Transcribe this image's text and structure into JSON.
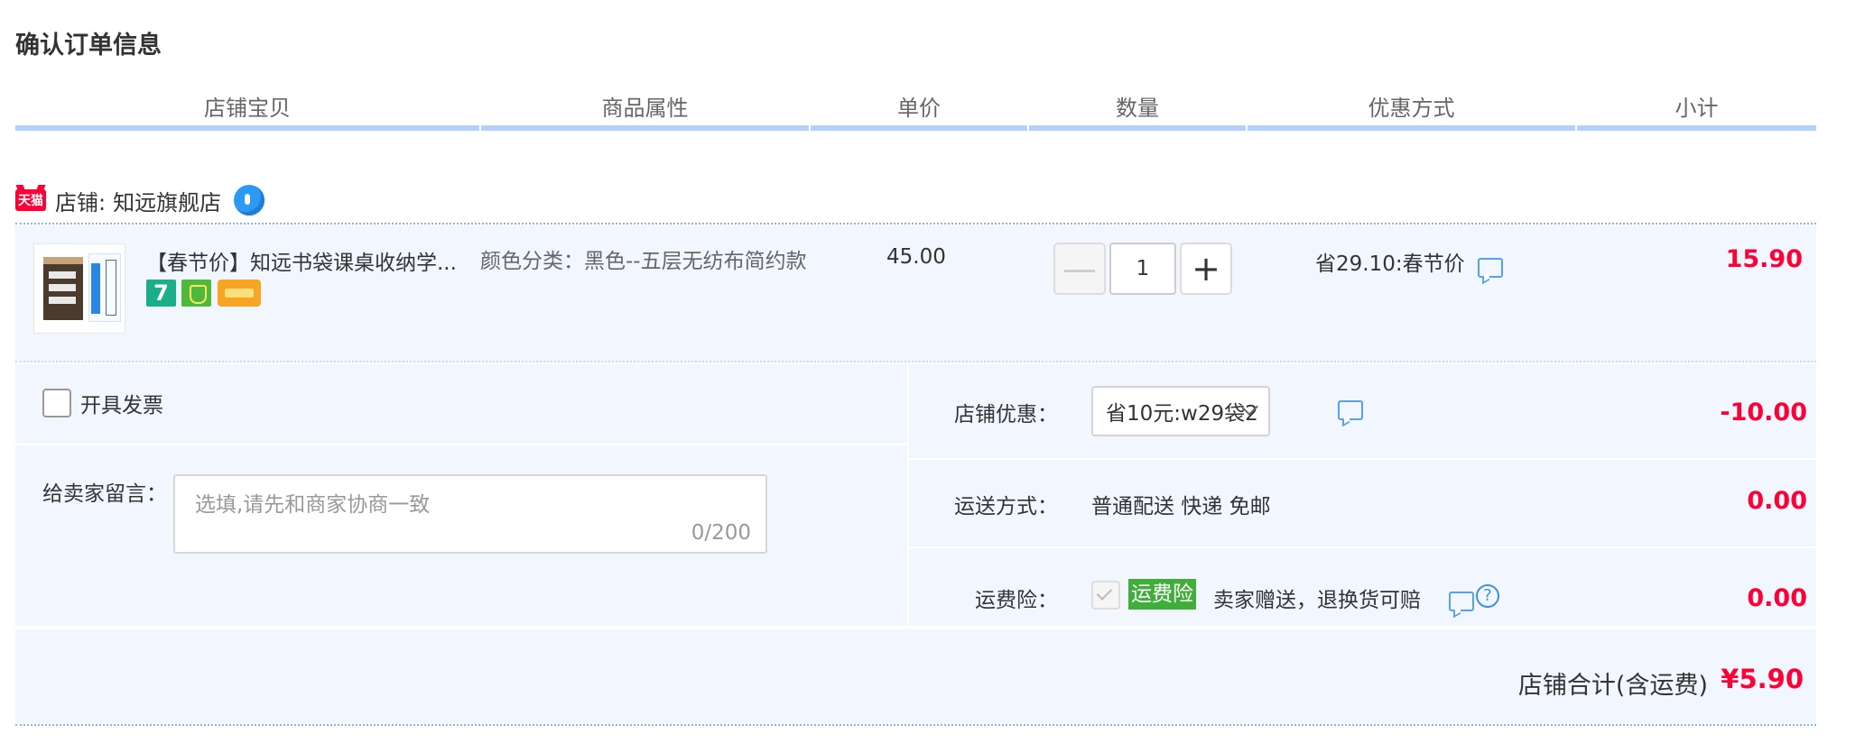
{
  "page": {
    "title": "确认订单信息"
  },
  "columns": [
    "店铺宝贝",
    "商品属性",
    "单价",
    "数量",
    "优惠方式",
    "小计"
  ],
  "shop": {
    "prefix": "店铺:",
    "name": "知远旗舰店",
    "tmall_logo_text": "天猫",
    "icon": "wangwang-chat-icon"
  },
  "item": {
    "title": "【春节价】知远书袋课桌收纳学...",
    "badge_7": "7",
    "attribute": "颜色分类：黑色--五层无纺布简约款",
    "unit_price": "45.00",
    "quantity": "1",
    "minus_label": "—",
    "plus_label": "+",
    "promo": "省29.10:春节价",
    "subtotal": "15.90"
  },
  "options": {
    "invoice_label": "开具发票",
    "message_label": "给卖家留言：",
    "message_placeholder": "选填,请先和商家协商一致",
    "message_count": "0/200"
  },
  "shop_discount": {
    "label": "店铺优惠：",
    "selected": "省10元:w29袋2",
    "value": "-10.00"
  },
  "shipping": {
    "label": "运送方式：",
    "method": "普通配送 快递 免邮",
    "value": "0.00"
  },
  "insurance": {
    "label": "运费险：",
    "tag": "运费险",
    "desc": "卖家赠送，退换货可赔",
    "value": "0.00",
    "help": "?"
  },
  "total": {
    "label": "店铺合计(含运费)",
    "value": "¥5.90"
  },
  "colors": {
    "accent_red": "#ff0036",
    "header_bar": "#b2d1ff",
    "panel_bg": "#f2f7ff",
    "insurance_green": "#3fae3a"
  }
}
